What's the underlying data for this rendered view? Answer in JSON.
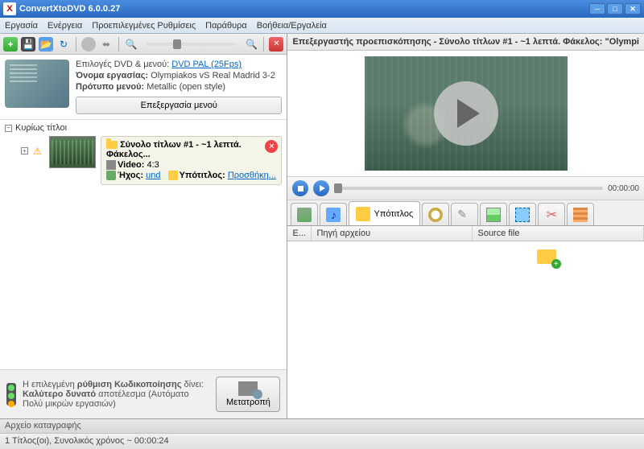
{
  "app": {
    "title": "ConvertXtoDVD 6.0.0.27"
  },
  "menu": {
    "file": "Εργασία",
    "action": "Ενέργεια",
    "presets": "Προεπιλεγμένες Ρυθμίσεις",
    "windows": "Παράθυρα",
    "help": "Βοήθεια/Εργαλεία"
  },
  "dvd": {
    "options_label": "Επιλογές DVD & μενού:",
    "options_link": "DVD PAL (25Fps)",
    "name_label": "Όνομα εργασίας:",
    "name_value": "Olympiakos vS Real Madrid 3-2",
    "template_label": "Πρότυπο μενού:",
    "template_value": "Metallic (open style)",
    "edit_menu": "Επεξεργασία μενού"
  },
  "tree": {
    "main_titles": "Κυρίως τίτλοι"
  },
  "title": {
    "header": "Σύνολο τίτλων #1 - ~1 λεπτά. Φάκελος...",
    "video_label": "Video:",
    "video_value": "4:3",
    "audio_label": "Ήχος:",
    "audio_link": "und",
    "sub_label": "Υπότιτλος:",
    "sub_link": "Προσθήκη..."
  },
  "quality": {
    "line1_a": "Η επιλεγμένη ",
    "line1_b": "ρύθμιση Κωδικοποίησης",
    "line1_c": " δίνει:",
    "line2_a": "Καλύτερο δυνατό",
    "line2_b": " αποτέλεσμα (Αυτόματο Πολύ μικρών εργασιών)",
    "convert": "Μετατροπή"
  },
  "preview": {
    "header": "Επεξεργαστής προεπισκόπησης - Σύνολο τίτλων #1 - ~1 λεπτά. Φάκελος: \"Olympi",
    "time": "00:00:00"
  },
  "tabs": {
    "subtitles": "Υπότιτλος"
  },
  "subtable": {
    "col1": "E...",
    "col2": "Πηγή αρχείου",
    "col3": "Source file"
  },
  "log": {
    "header": "Αρχείο καταγραφής"
  },
  "status": {
    "text": "1 Τίτλος(οι), Συνολικός χρόνος ~ 00:00:24"
  }
}
